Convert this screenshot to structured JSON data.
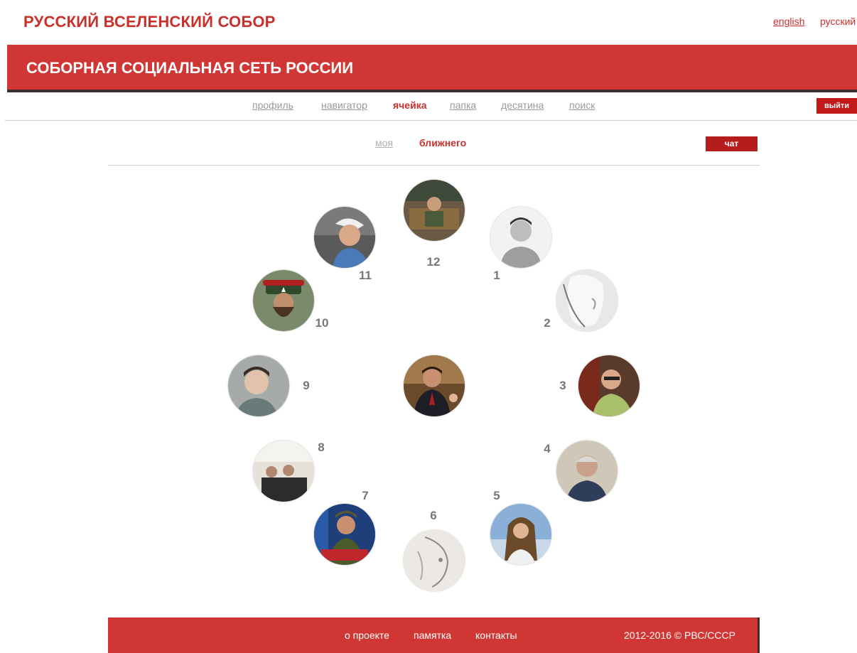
{
  "header": {
    "site_title": "РУССКИЙ ВСЕЛЕНСКИЙ СОБОР",
    "lang_en": "english",
    "lang_ru": "русский"
  },
  "banner": {
    "title": "СОБОРНАЯ СОЦИАЛЬНАЯ СЕТЬ РОССИИ"
  },
  "nav": {
    "items": [
      {
        "label": "профиль"
      },
      {
        "label": "навигатор"
      },
      {
        "label": "ячейка",
        "active": true
      },
      {
        "label": "папка"
      },
      {
        "label": "десятина"
      },
      {
        "label": "поиск"
      }
    ],
    "logout": "выйти"
  },
  "subtabs": {
    "my": "моя",
    "neighbor": "ближнего",
    "chat": "чат"
  },
  "cell": {
    "numbers": [
      "1",
      "2",
      "3",
      "4",
      "5",
      "6",
      "7",
      "8",
      "9",
      "10",
      "11",
      "12"
    ]
  },
  "footer": {
    "about": "о проекте",
    "memo": "памятка",
    "contacts": "контакты",
    "copyright": "2012-2016 © РВС/СССР"
  },
  "colors": {
    "accent": "#d03634",
    "accent_dark": "#b71c1c",
    "muted_link": "#9a9a9a"
  }
}
